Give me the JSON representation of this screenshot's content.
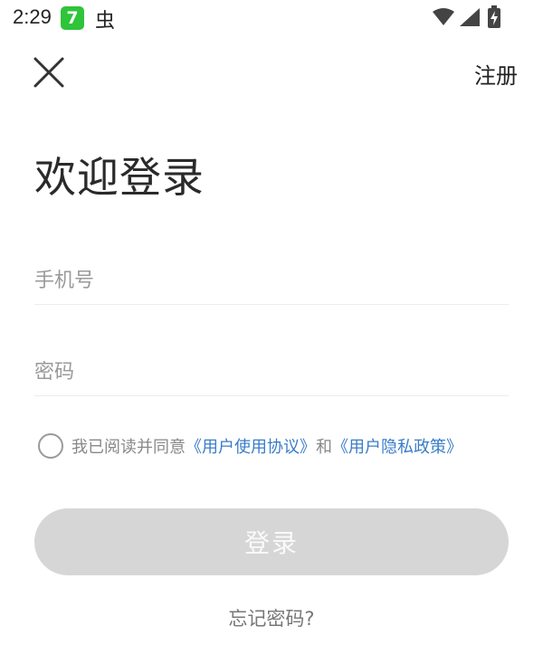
{
  "status_bar": {
    "time": "2:29",
    "app_badge": "7",
    "bug_glyph": "虫"
  },
  "header": {
    "register_label": "注册"
  },
  "main": {
    "title": "欢迎登录",
    "phone_placeholder": "手机号",
    "password_placeholder": "密码",
    "agreement": {
      "prefix": "我已阅读并同意",
      "user_agreement": "《用户使用协议》",
      "conjunction": "和",
      "privacy_policy": "《用户隐私政策》"
    },
    "login_label": "登录",
    "forgot_password": "忘记密码?"
  },
  "colors": {
    "link": "#3a7cc7",
    "button_disabled": "#d6d6d6",
    "app_badge": "#2fc43a"
  },
  "icons": [
    "wifi-icon",
    "signal-icon",
    "battery-icon",
    "close-icon",
    "radio-unchecked-icon"
  ]
}
